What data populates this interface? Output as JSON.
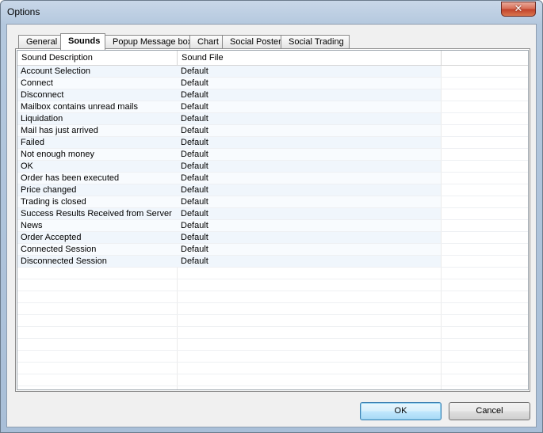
{
  "window": {
    "title": "Options",
    "close_symbol": "✕"
  },
  "tabs": [
    {
      "label": "General",
      "active": false
    },
    {
      "label": "Sounds",
      "active": true
    },
    {
      "label": "Popup Message box",
      "active": false
    },
    {
      "label": "Chart",
      "active": false
    },
    {
      "label": "Social Poster",
      "active": false
    },
    {
      "label": "Social Trading",
      "active": false
    }
  ],
  "sounds": {
    "columns": [
      "Sound Description",
      "Sound File"
    ],
    "rows": [
      {
        "description": "Account Selection",
        "file": "Default"
      },
      {
        "description": "Connect",
        "file": "Default"
      },
      {
        "description": "Disconnect",
        "file": "Default"
      },
      {
        "description": "Mailbox contains unread mails",
        "file": "Default"
      },
      {
        "description": "Liquidation",
        "file": "Default"
      },
      {
        "description": "Mail has just arrived",
        "file": "Default"
      },
      {
        "description": "Failed",
        "file": "Default"
      },
      {
        "description": "Not enough money",
        "file": "Default"
      },
      {
        "description": "OK",
        "file": "Default"
      },
      {
        "description": "Order has been executed",
        "file": "Default"
      },
      {
        "description": "Price changed",
        "file": "Default"
      },
      {
        "description": "Trading is closed",
        "file": "Default"
      },
      {
        "description": "Success Results Received from Server",
        "file": "Default"
      },
      {
        "description": "News",
        "file": "Default"
      },
      {
        "description": "Order Accepted",
        "file": "Default"
      },
      {
        "description": "Connected Session",
        "file": "Default"
      },
      {
        "description": "Disconnected Session",
        "file": "Default"
      }
    ]
  },
  "buttons": {
    "ok_label": "OK",
    "cancel_label": "Cancel"
  }
}
